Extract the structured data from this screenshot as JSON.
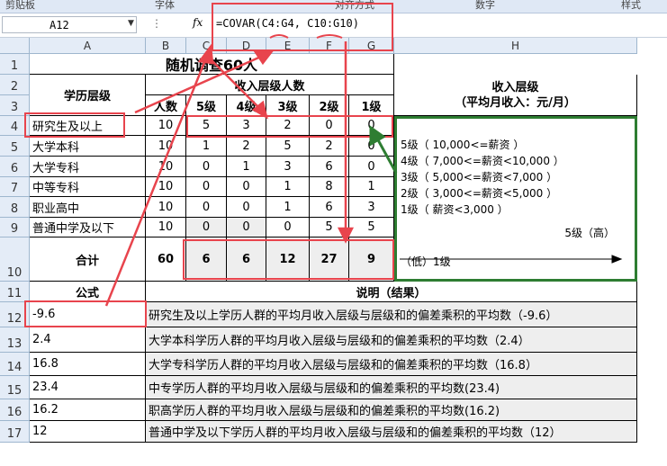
{
  "ribbon": {
    "labels": [
      "剪贴板",
      "字体",
      "对齐方式",
      "数字",
      "样式"
    ]
  },
  "formula_bar": {
    "name_box": "A12",
    "fx": "fx",
    "formula": "=COVAR(C4:G4, C10:G10)"
  },
  "columns": [
    "A",
    "B",
    "C",
    "D",
    "E",
    "F",
    "G",
    "H"
  ],
  "rows": [
    "1",
    "2",
    "3",
    "4",
    "5",
    "6",
    "7",
    "8",
    "9",
    "10",
    "11",
    "12",
    "13",
    "14",
    "15",
    "16",
    "17"
  ],
  "sheet": {
    "title": "随机调查60人",
    "edu_header": "学历层级",
    "income_header": "收入层级人数",
    "count_header": "人数",
    "levels": [
      "5级",
      "4级",
      "3级",
      "2级",
      "1级"
    ],
    "side_title": "收入层级",
    "side_subtitle": "（平均月收入：元/月）",
    "side_lines": [
      "5级（  10,000<=薪资  ）",
      "4级（  7,000<=薪资<10,000  ）",
      "3级（  5,000<=薪资<7,000  ）",
      "2级（  3,000<=薪资<5,000  ）",
      "1级（  薪资<3,000  ）"
    ],
    "axis_high": "5级（高）",
    "axis_low": "（低）1级",
    "data_rows": [
      {
        "name": "研究生及以上",
        "count": "10",
        "vals": [
          "5",
          "3",
          "2",
          "0",
          "0"
        ]
      },
      {
        "name": "大学本科",
        "count": "10",
        "vals": [
          "1",
          "2",
          "5",
          "2",
          "0"
        ]
      },
      {
        "name": "大学专科",
        "count": "10",
        "vals": [
          "0",
          "1",
          "3",
          "6",
          "0"
        ]
      },
      {
        "name": "中等专科",
        "count": "10",
        "vals": [
          "0",
          "0",
          "1",
          "8",
          "1"
        ]
      },
      {
        "name": "职业高中",
        "count": "10",
        "vals": [
          "0",
          "0",
          "1",
          "6",
          "3"
        ]
      },
      {
        "name": "普通中学及以下",
        "count": "10",
        "vals": [
          "0",
          "0",
          "0",
          "5",
          "5"
        ]
      }
    ],
    "total_label": "合计",
    "total_count": "60",
    "total_vals": [
      "6",
      "6",
      "12",
      "27",
      "9"
    ],
    "formula_header": "公式",
    "desc_header": "说明（结果）",
    "results": [
      {
        "value": "-9.6",
        "desc": "研究生及以上学历人群的平均月收入层级与层级和的偏差乘积的平均数（-9.6）"
      },
      {
        "value": "2.4",
        "desc": "大学本科学历人群的平均月收入层级与层级和的偏差乘积的平均数（2.4）"
      },
      {
        "value": "16.8",
        "desc": "大学专科学历人群的平均月收入层级与层级和的偏差乘积的平均数（16.8）"
      },
      {
        "value": "23.4",
        "desc": "中专学历人群的平均月收入层级与层级和的偏差乘积的平均数(23.4)"
      },
      {
        "value": "16.2",
        "desc": "职高学历人群的平均月收入层级与层级和的偏差乘积的平均数(16.2)"
      },
      {
        "value": "12",
        "desc": "普通中学及以下学历人群的平均月收入层级与层级和的偏差乘积的平均数（12）"
      }
    ]
  },
  "colors": {
    "highlight": "#e8444d",
    "green_box": "#2e7d32",
    "header_bg": "#e4ecf7"
  }
}
